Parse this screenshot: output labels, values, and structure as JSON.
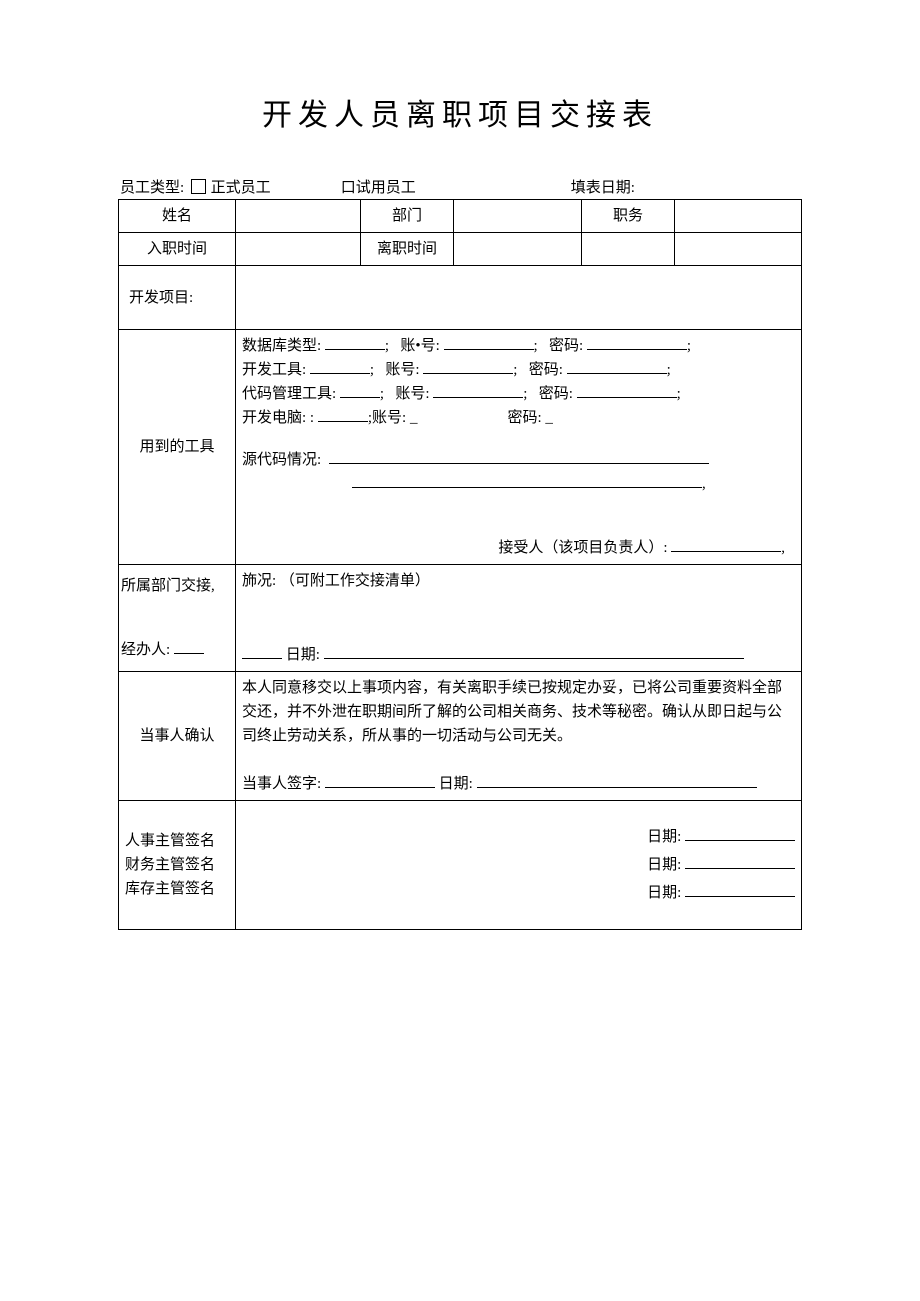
{
  "title": "开发人员离职项目交接表",
  "header": {
    "emp_type_label": "员工类型:",
    "formal_label": "正式员工",
    "trial_label": "口试用员工",
    "fill_date_label": "填表日期:"
  },
  "row1": {
    "name_label": "姓名",
    "dept_label": "部门",
    "position_label": "职务"
  },
  "row2": {
    "hire_date_label": "入职时间",
    "leave_date_label": "离职时间"
  },
  "project": {
    "label": "开发项目:"
  },
  "tools": {
    "label": "用到的工具",
    "db_type": "数据库类型:",
    "account_dot": "账•号:",
    "account": "账号:",
    "pwd": "密码:",
    "dev_tool": "开发工具:",
    "code_tool": "代码管理工具:",
    "dev_pc": "开发电脑: :",
    "src_status": "源代码情况:",
    "recipient": "接受人（该项目负责人）:"
  },
  "dept": {
    "left1": "所属部门交接,",
    "left2": "经办人:",
    "body1": "斾况:  （可附工作交接清单）",
    "date_label": "日期:"
  },
  "confirm": {
    "label": "当事人确认",
    "text": "本人同意移交以上事项内容，有关离职手续已按规定办妥，已将公司重要资料全部交还，并不外泄在职期间所了解的公司相关商务、技术等秘密。确认从即日起与公司终止劳动关系，所从事的一切活动与公司无关。",
    "sig_label": "当事人签字:",
    "date_label": "日期:"
  },
  "sigs": {
    "left_text": "人事主管签名财务主管签名库存主管签名",
    "date_label": "日期:"
  }
}
